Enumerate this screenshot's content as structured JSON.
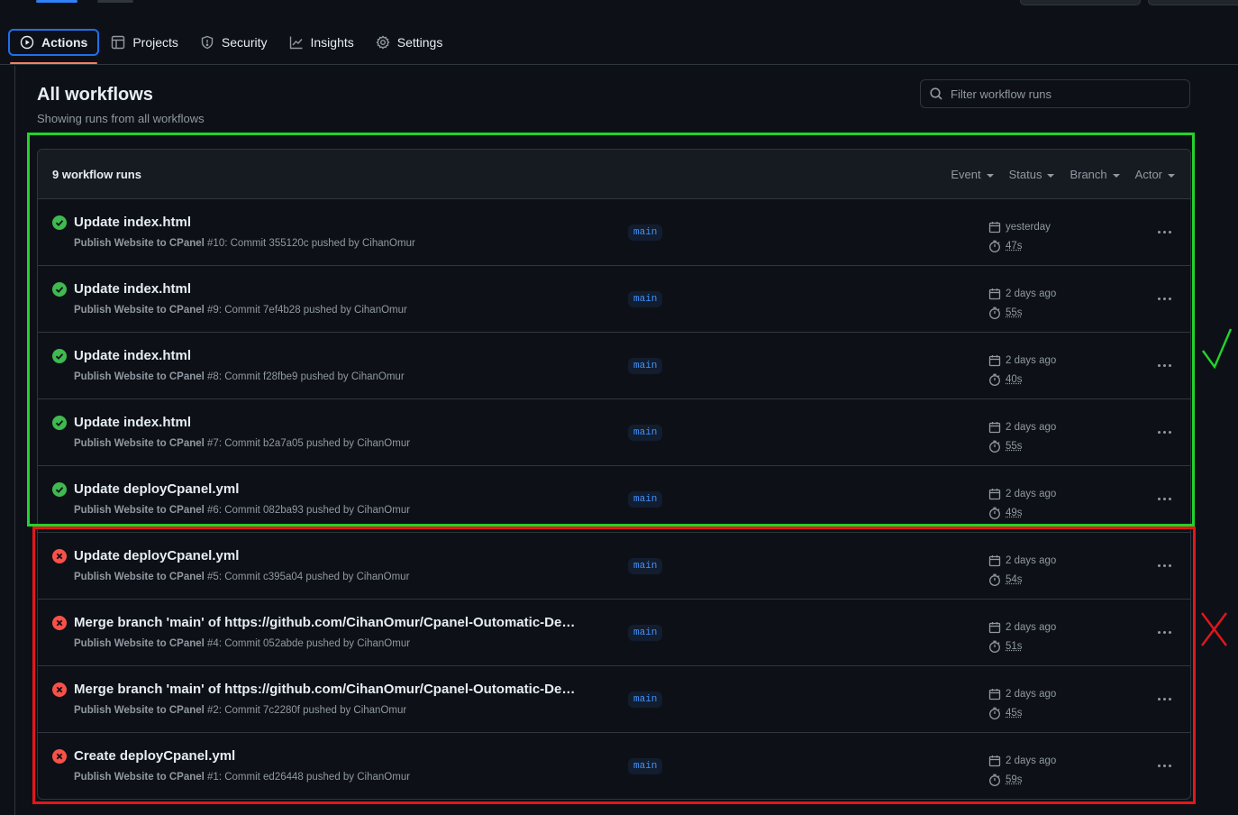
{
  "repo_nav": {
    "items": [
      {
        "label": "Actions",
        "icon": "play-icon",
        "selected": true
      },
      {
        "label": "Projects",
        "icon": "table-icon",
        "selected": false
      },
      {
        "label": "Security",
        "icon": "shield-icon",
        "selected": false
      },
      {
        "label": "Insights",
        "icon": "graph-icon",
        "selected": false
      },
      {
        "label": "Settings",
        "icon": "gear-icon",
        "selected": false
      }
    ]
  },
  "page": {
    "title": "All workflows",
    "subtitle": "Showing runs from all workflows",
    "filter_placeholder": "Filter workflow runs"
  },
  "runs_header": {
    "count_label": "9 workflow runs",
    "filters": [
      "Event",
      "Status",
      "Branch",
      "Actor"
    ]
  },
  "runs": [
    {
      "status": "success",
      "title": "Update index.html",
      "workflow": "Publish Website to CPanel",
      "details": " #10: Commit 355120c pushed by CihanOmur",
      "branch": "main",
      "when": "yesterday",
      "duration": "47s"
    },
    {
      "status": "success",
      "title": "Update index.html",
      "workflow": "Publish Website to CPanel",
      "details": " #9: Commit 7ef4b28 pushed by CihanOmur",
      "branch": "main",
      "when": "2 days ago",
      "duration": "55s"
    },
    {
      "status": "success",
      "title": "Update index.html",
      "workflow": "Publish Website to CPanel",
      "details": " #8: Commit f28fbe9 pushed by CihanOmur",
      "branch": "main",
      "when": "2 days ago",
      "duration": "40s"
    },
    {
      "status": "success",
      "title": "Update index.html",
      "workflow": "Publish Website to CPanel",
      "details": " #7: Commit b2a7a05 pushed by CihanOmur",
      "branch": "main",
      "when": "2 days ago",
      "duration": "55s"
    },
    {
      "status": "success",
      "title": "Update deployCpanel.yml",
      "workflow": "Publish Website to CPanel",
      "details": " #6: Commit 082ba93 pushed by CihanOmur",
      "branch": "main",
      "when": "2 days ago",
      "duration": "49s"
    },
    {
      "status": "failure",
      "title": "Update deployCpanel.yml",
      "workflow": "Publish Website to CPanel",
      "details": " #5: Commit c395a04 pushed by CihanOmur",
      "branch": "main",
      "when": "2 days ago",
      "duration": "54s"
    },
    {
      "status": "failure",
      "title": "Merge branch 'main' of https://github.com/CihanOmur/Cpanel-Outomatic-Deploy",
      "workflow": "Publish Website to CPanel",
      "details": " #4: Commit 052abde pushed by CihanOmur",
      "branch": "main",
      "when": "2 days ago",
      "duration": "51s"
    },
    {
      "status": "failure",
      "title": "Merge branch 'main' of https://github.com/CihanOmur/Cpanel-Outomatic-Deploy",
      "workflow": "Publish Website to CPanel",
      "details": " #2: Commit 7c2280f pushed by CihanOmur",
      "branch": "main",
      "when": "2 days ago",
      "duration": "45s"
    },
    {
      "status": "failure",
      "title": "Create deployCpanel.yml",
      "workflow": "Publish Website to CPanel",
      "details": " #1: Commit ed26448 pushed by CihanOmur",
      "branch": "main",
      "when": "2 days ago",
      "duration": "59s"
    }
  ],
  "colors": {
    "success": "#3fb950",
    "failure": "#f85149",
    "annotation_green": "#22d32c",
    "annotation_red": "#e3161b",
    "accent": "#1f6feb"
  }
}
